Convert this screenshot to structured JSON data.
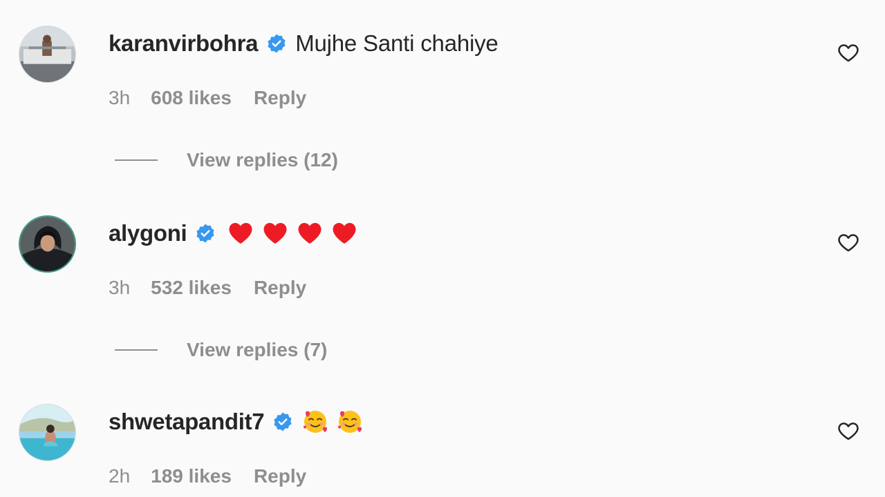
{
  "comments": [
    {
      "username": "karanvirbohra",
      "verified": true,
      "text": "Mujhe Santi chahiye",
      "time": "3h",
      "likes": "608 likes",
      "reply_label": "Reply",
      "view_replies": "View replies (12)",
      "avatar_icon": "profile-photo"
    },
    {
      "username": "alygoni",
      "verified": true,
      "text": "",
      "emojis": [
        "red-heart-emoji",
        "red-heart-emoji",
        "red-heart-emoji",
        "red-heart-emoji"
      ],
      "time": "3h",
      "likes": "532 likes",
      "reply_label": "Reply",
      "view_replies": "View replies (7)",
      "avatar_icon": "profile-photo"
    },
    {
      "username": "shwetapandit7",
      "verified": true,
      "text": "",
      "emojis": [
        "smiling-face-with-hearts-emoji",
        "smiling-face-with-hearts-emoji"
      ],
      "time": "2h",
      "likes": "189 likes",
      "reply_label": "Reply",
      "avatar_icon": "profile-photo"
    }
  ],
  "colors": {
    "background": "#fafafa",
    "text_primary": "#262626",
    "text_secondary": "#8e8e8e",
    "verified_blue": "#3897f0",
    "heart_red": "#ed1c24"
  },
  "icons": {
    "like": "heart-outline-icon",
    "verified": "verified-badge-icon"
  }
}
